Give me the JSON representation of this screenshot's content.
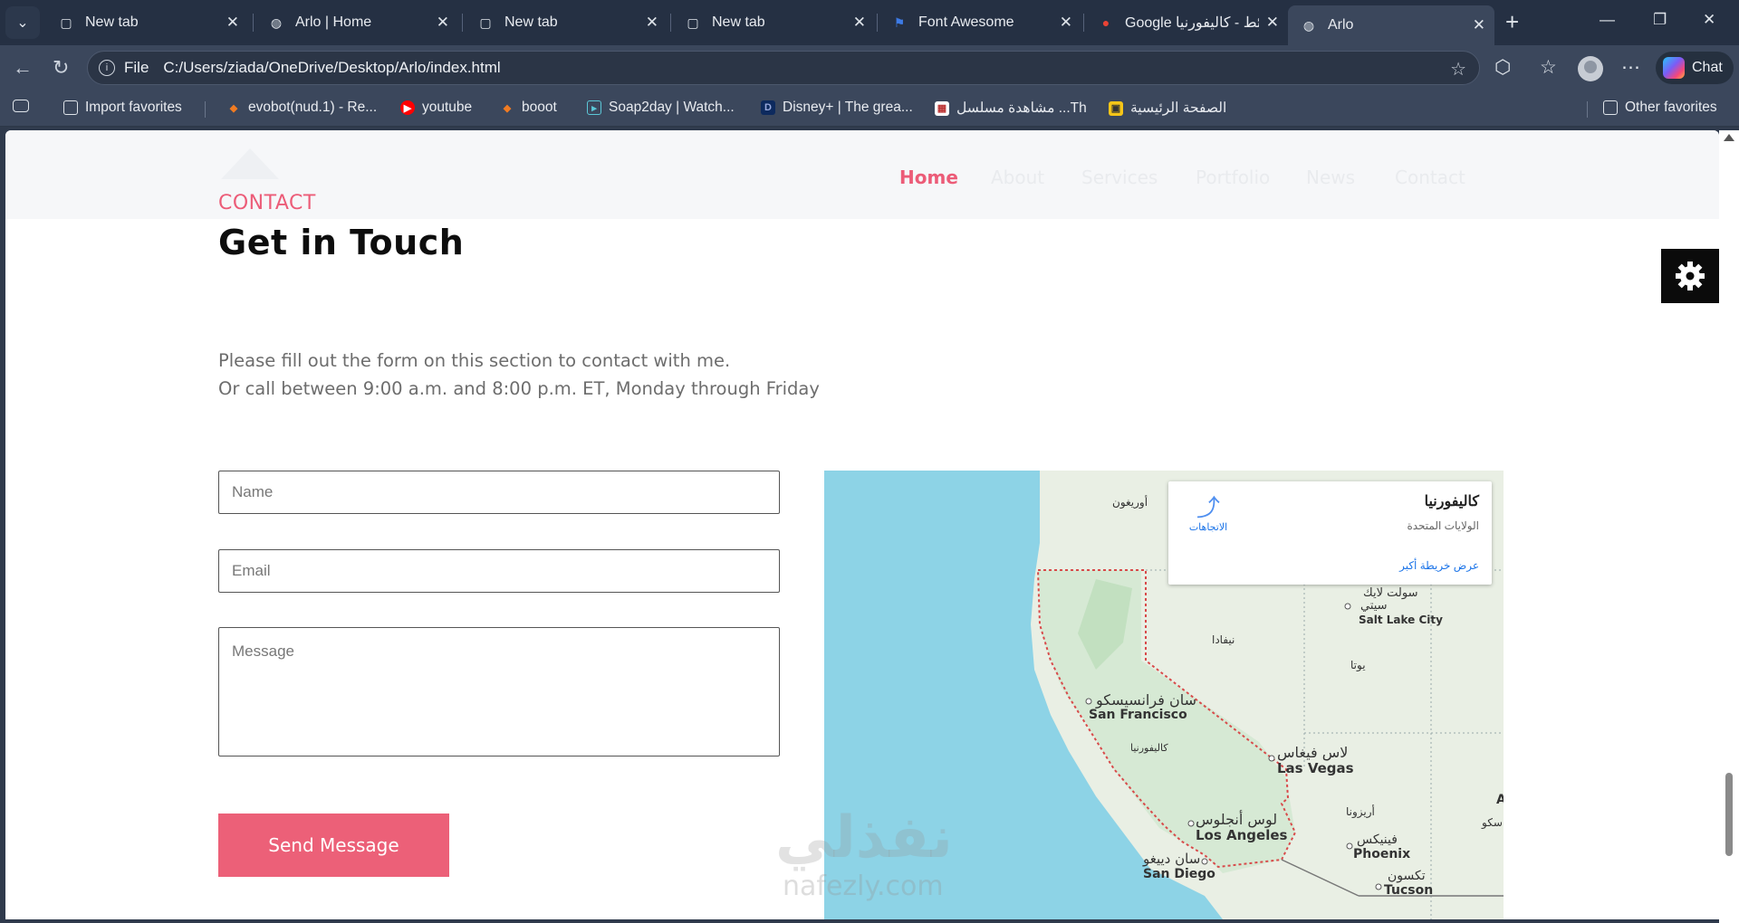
{
  "browser": {
    "tabs": [
      {
        "title": "New tab",
        "icon": "page-icon"
      },
      {
        "title": "Arlo | Home",
        "icon": "globe-icon"
      },
      {
        "title": "New tab",
        "icon": "page-icon"
      },
      {
        "title": "New tab",
        "icon": "page-icon"
      },
      {
        "title": "Font Awesome",
        "icon": "flag-icon"
      },
      {
        "title": "Google خرائط - كاليفورنيا",
        "icon": "maps-pin-icon"
      },
      {
        "title": "Arlo",
        "icon": "globe-icon",
        "active": true
      }
    ],
    "address": {
      "scheme": "File",
      "url": "C:/Users/ziada/OneDrive/Desktop/Arlo/index.html"
    },
    "chat_label": "Chat",
    "bookmarks": [
      {
        "label": "Import favorites",
        "color": "#dfe4ea"
      },
      {
        "label": "evobot(nud.1) - Re...",
        "color": "#f07b22"
      },
      {
        "label": "youtube",
        "color": "#ff0000"
      },
      {
        "label": "booot",
        "color": "#f07b22"
      },
      {
        "label": "Soap2day | Watch...",
        "color": "#5cc8d8"
      },
      {
        "label": "Disney+ | The grea...",
        "color": "#1a3f8c"
      },
      {
        "label": "مشاهدة مسلسل ...Th",
        "color": "#ffffff"
      },
      {
        "label": "الصفحة الرئيسية",
        "color": "#f5c518"
      }
    ],
    "other_favorites": "Other favorites"
  },
  "site": {
    "nav": {
      "items": [
        "Home",
        "About",
        "Services",
        "Portfolio",
        "News",
        "Contact"
      ],
      "active": "Home",
      "accent": "#ec5c78"
    },
    "contact": {
      "tag": "CONTACT",
      "title": "Get in Touch",
      "intro_line1": "Please fill out the form on this section to contact with me.",
      "intro_line2": "Or call between 9:00 a.m. and 8:00 p.m. ET, Monday through Friday",
      "name_placeholder": "Name",
      "email_placeholder": "Email",
      "message_placeholder": "Message",
      "send_label": "Send Message"
    },
    "settings_icon": "gear-icon"
  },
  "map": {
    "card": {
      "title": "كاليفورنيا",
      "subtitle": "الولايات المتحدة",
      "directions": "الاتجاهات",
      "larger_map": "عرض خريطة أكبر"
    },
    "labels": {
      "oregon": "أوريغون",
      "nevada": "نيفادا",
      "utah": "يوتا",
      "california": "كاليفورنيا",
      "arizona": "أريزونا",
      "slc_ar": "سولت لايك",
      "slc_ar2": "سيتي",
      "slc": "Salt Lake City",
      "sf_ar": "سان فرانسيسكو",
      "sf": "San Francisco",
      "lv_ar": "لاس فيغاس",
      "lv": "Las Vegas",
      "la_ar": "لوس أنجلوس",
      "la": "Los Angeles",
      "sd_ar": "سان دييغو",
      "sd": "San Diego",
      "phx_ar": "فينيكس",
      "phx": "Phoenix",
      "tuc_ar": "تكسون",
      "tuc": "Tucson",
      "edge_ar": "سكو",
      "edge_a": "A"
    }
  },
  "watermark": {
    "arabic": "نفذلي",
    "latin": "nafezly.com"
  }
}
